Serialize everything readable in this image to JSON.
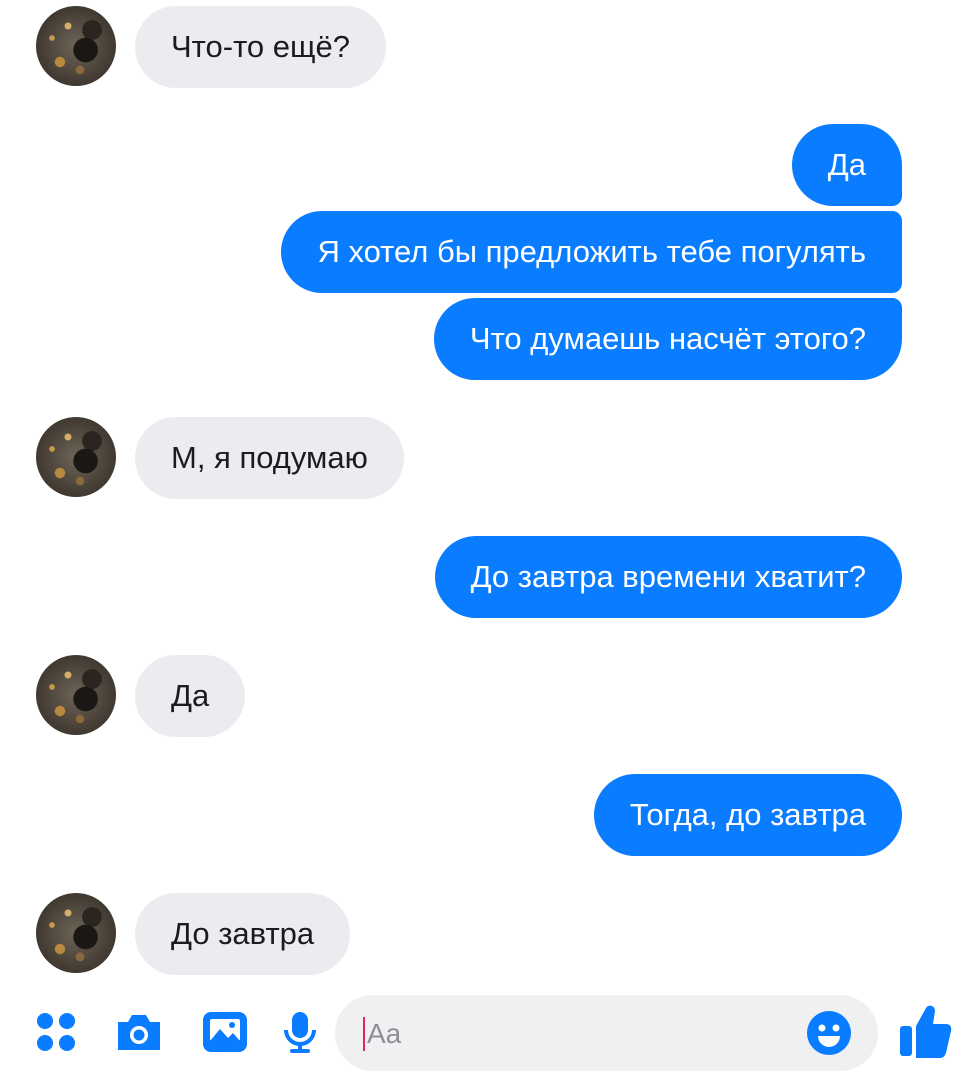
{
  "conversation": {
    "messages": [
      {
        "direction": "in",
        "text": "Что-то ещё?"
      },
      {
        "direction": "out",
        "text": "Да"
      },
      {
        "direction": "out",
        "text": "Я хотел бы предложить тебе погулять"
      },
      {
        "direction": "out",
        "text": "Что думаешь насчёт этого?"
      },
      {
        "direction": "in",
        "text": "М, я подумаю"
      },
      {
        "direction": "out",
        "text": "До завтра времени хватит?"
      },
      {
        "direction": "in",
        "text": "Да"
      },
      {
        "direction": "out",
        "text": "Тогда, до завтра"
      },
      {
        "direction": "in",
        "text": "До завтра"
      }
    ]
  },
  "composer": {
    "placeholder": "Aa",
    "value": "",
    "icons": [
      "apps-grid-icon",
      "camera-icon",
      "gallery-icon",
      "microphone-icon",
      "emoji-icon",
      "thumbs-up-icon"
    ],
    "accent_color": "#0a7cff"
  },
  "colors": {
    "outgoing_bubble": "#0a7cff",
    "incoming_bubble": "#ececf0"
  }
}
